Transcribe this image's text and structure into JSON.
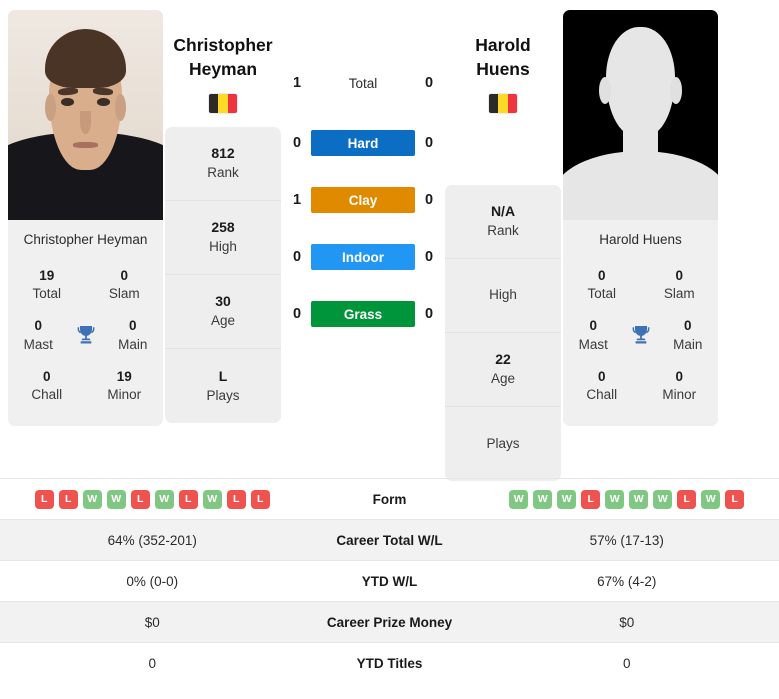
{
  "players": {
    "left": {
      "name_line1": "Christopher",
      "name_line2": "Heyman",
      "full_name": "Christopher Heyman",
      "photo_caption": "Christopher Heyman",
      "country": "Belgium",
      "flag_colors": [
        "#2d2926",
        "#fdda25",
        "#ef3340"
      ],
      "avatar_type": "photo",
      "info": [
        {
          "value": "812",
          "label": "Rank"
        },
        {
          "value": "258",
          "label": "High"
        },
        {
          "value": "30",
          "label": "Age"
        },
        {
          "value": "L",
          "label": "Plays"
        }
      ],
      "titles": [
        {
          "value": "19",
          "label": "Total"
        },
        {
          "value": "0",
          "label": "Slam"
        },
        {
          "value": "0",
          "label": "Mast"
        },
        {
          "value": "0",
          "label": "Main"
        },
        {
          "value": "0",
          "label": "Chall"
        },
        {
          "value": "19",
          "label": "Minor"
        }
      ],
      "form": [
        "L",
        "L",
        "W",
        "W",
        "L",
        "W",
        "L",
        "W",
        "L",
        "L"
      ],
      "career_total_wl": "64% (352-201)",
      "ytd_wl": "0% (0-0)",
      "career_prize_money": "$0",
      "ytd_titles": "0"
    },
    "right": {
      "name_line1": "Harold",
      "name_line2": "Huens",
      "full_name": "Harold Huens",
      "photo_caption": "Harold Huens",
      "country": "Belgium",
      "flag_colors": [
        "#2d2926",
        "#fdda25",
        "#ef3340"
      ],
      "avatar_type": "silhouette",
      "info": [
        {
          "value": "N/A",
          "label": "Rank"
        },
        {
          "value": "",
          "label": "High"
        },
        {
          "value": "22",
          "label": "Age"
        },
        {
          "value": "",
          "label": "Plays"
        }
      ],
      "titles": [
        {
          "value": "0",
          "label": "Total"
        },
        {
          "value": "0",
          "label": "Slam"
        },
        {
          "value": "0",
          "label": "Mast"
        },
        {
          "value": "0",
          "label": "Main"
        },
        {
          "value": "0",
          "label": "Chall"
        },
        {
          "value": "0",
          "label": "Minor"
        }
      ],
      "form": [
        "W",
        "W",
        "W",
        "L",
        "W",
        "W",
        "W",
        "L",
        "W",
        "L"
      ],
      "career_total_wl": "57% (17-13)",
      "ytd_wl": "67% (4-2)",
      "career_prize_money": "$0",
      "ytd_titles": "0"
    }
  },
  "head_to_head": {
    "rows": [
      {
        "label": "Total",
        "left": "1",
        "right": "0",
        "style": "plain",
        "color": ""
      },
      {
        "label": "Hard",
        "left": "0",
        "right": "0",
        "style": "bar",
        "color": "#0b6ec2"
      },
      {
        "label": "Clay",
        "left": "1",
        "right": "0",
        "style": "bar",
        "color": "#e08a00"
      },
      {
        "label": "Indoor",
        "left": "0",
        "right": "0",
        "style": "bar",
        "color": "#2196f3"
      },
      {
        "label": "Grass",
        "left": "0",
        "right": "0",
        "style": "bar",
        "color": "#00953b"
      }
    ]
  },
  "trophy_icon": {
    "name": "trophy-icon",
    "color": "#3f72b5"
  },
  "badge_colors": {
    "win": "#81c784",
    "loss": "#ef5350"
  },
  "comparison_table": {
    "rows": [
      {
        "label": "Form",
        "type": "form",
        "left": "",
        "right": ""
      },
      {
        "label": "Career Total W/L",
        "type": "text",
        "left": "64% (352-201)",
        "right": "57% (17-13)"
      },
      {
        "label": "YTD W/L",
        "type": "text",
        "left": "0% (0-0)",
        "right": "67% (4-2)"
      },
      {
        "label": "Career Prize Money",
        "type": "text",
        "left": "$0",
        "right": "$0"
      },
      {
        "label": "YTD Titles",
        "type": "text",
        "left": "0",
        "right": "0"
      }
    ]
  }
}
